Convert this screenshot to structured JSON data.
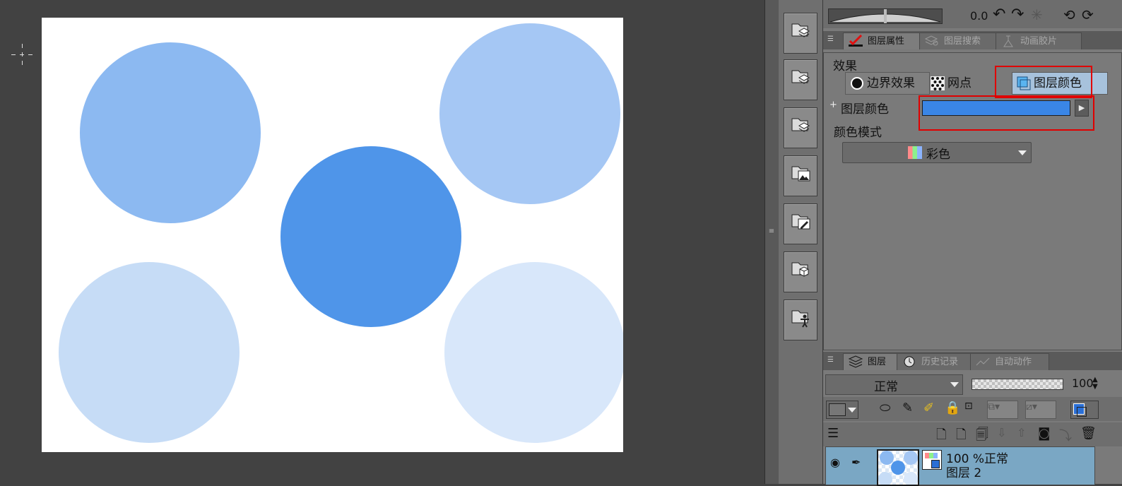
{
  "canvas": {
    "circles": [
      {
        "name": "circle-top-left",
        "color": "#8cb9f1"
      },
      {
        "name": "circle-top-right",
        "color": "#a5c7f4"
      },
      {
        "name": "circle-center",
        "color": "#4f95e9"
      },
      {
        "name": "circle-bottom-left",
        "color": "#c6dcf6"
      },
      {
        "name": "circle-bottom-right",
        "color": "#d8e7fa"
      }
    ]
  },
  "navigator": {
    "rotation": "0.0"
  },
  "properties_panel": {
    "tabs": [
      {
        "label": "图层属性",
        "icon": "layer-property-icon"
      },
      {
        "label": "图层搜索",
        "icon": "layer-search-icon"
      },
      {
        "label": "动画胶片",
        "icon": "animation-cels-icon"
      }
    ],
    "effect_label": "效果",
    "effect_buttons": [
      {
        "label": "边界效果",
        "icon": "border-effect-icon"
      },
      {
        "label": "网点",
        "icon": "tone-icon"
      },
      {
        "label": "图层颜色",
        "icon": "layer-color-icon"
      }
    ],
    "layer_color_label": "图层颜色",
    "layer_color_expand": "+",
    "layer_color_value": "#3a86e6",
    "color_mode_label": "颜色模式",
    "color_mode_value": "彩色",
    "highlight_color": "#e00000"
  },
  "layer_panel": {
    "tabs": [
      {
        "label": "图层",
        "icon": "layer-icon"
      },
      {
        "label": "历史记录",
        "icon": "history-icon"
      },
      {
        "label": "自动动作",
        "icon": "auto-action-icon"
      }
    ],
    "blend_mode": "正常",
    "opacity": "100",
    "layer": {
      "info": "100 %正常",
      "name": "图层 2"
    }
  }
}
